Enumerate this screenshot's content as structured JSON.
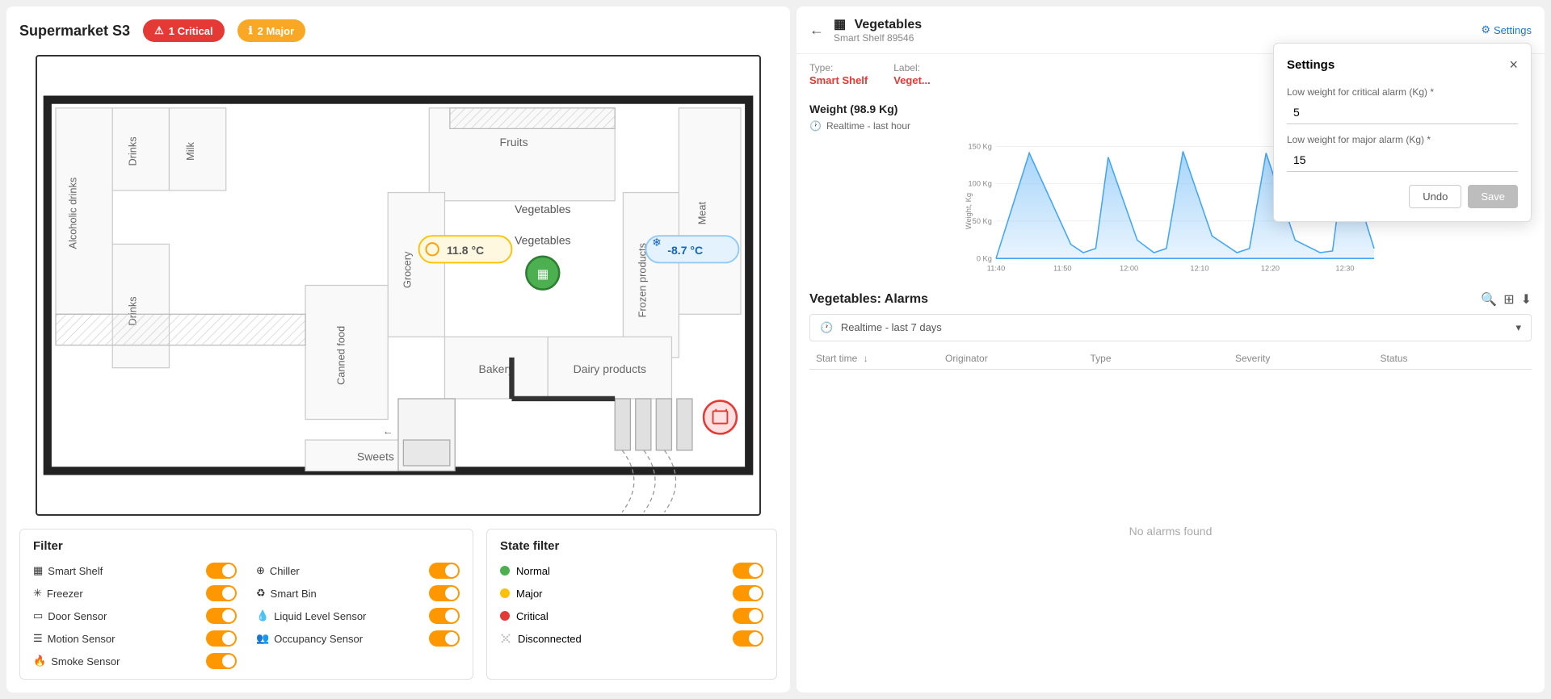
{
  "leftPanel": {
    "title": "Supermarket S3",
    "alerts": [
      {
        "type": "critical",
        "count": 1,
        "label": "1 Critical"
      },
      {
        "type": "major",
        "count": 2,
        "label": "2 Major"
      }
    ],
    "floorplan": {
      "sections": [
        "Fruits",
        "Drinks",
        "Milk",
        "Meat",
        "Alcoholic drinks",
        "Vegetables",
        "Frozen products",
        "Drinks",
        "Grocery",
        "Bakery",
        "Dairy products",
        "Canned food",
        "Sweets"
      ],
      "tempBadge1": "11.8 °C",
      "tempBadge2": "-8.7 °C"
    },
    "filter": {
      "title": "Filter",
      "items": [
        {
          "label": "Smart Shelf",
          "enabled": true
        },
        {
          "label": "Freezer",
          "enabled": true
        },
        {
          "label": "Door Sensor",
          "enabled": true
        },
        {
          "label": "Motion Sensor",
          "enabled": true
        },
        {
          "label": "Smoke Sensor",
          "enabled": true
        },
        {
          "label": "Chiller",
          "enabled": true
        },
        {
          "label": "Smart Bin",
          "enabled": true
        },
        {
          "label": "Liquid Level Sensor",
          "enabled": true
        },
        {
          "label": "Occupancy Sensor",
          "enabled": true
        }
      ]
    },
    "stateFilter": {
      "title": "State filter",
      "states": [
        {
          "label": "Normal",
          "color": "#4caf50",
          "enabled": true
        },
        {
          "label": "Major",
          "color": "#ffc107",
          "enabled": true
        },
        {
          "label": "Critical",
          "color": "#e53935",
          "enabled": true
        },
        {
          "label": "Disconnected",
          "color": "#bdbdbd",
          "enabled": true
        }
      ]
    }
  },
  "rightPanel": {
    "backArrow": "←",
    "deviceName": "Vegetables",
    "deviceId": "Smart Shelf 89546",
    "settingsLabel": "Settings",
    "meta": {
      "typeLabel": "Type:",
      "typeValue": "Smart Shelf",
      "labelLabel": "Label:",
      "labelValue": "Veget..."
    },
    "weight": {
      "title": "Weight (98.9 Kg)",
      "realtimeLabel": "Realtime - last hour",
      "chartYLabels": [
        "150 Kg",
        "100 Kg",
        "50 Kg",
        "0 Kg"
      ],
      "chartXLabels": [
        "11:40",
        "11:50",
        "12:00",
        "12:10",
        "12:20",
        "12:30"
      ],
      "chartYAxisLabel": "Weight, Kg"
    },
    "alarms": {
      "title": "Vegetables: Alarms",
      "realtimeLabel": "Realtime - last 7 days",
      "columns": [
        "Start time",
        "Originator",
        "Type",
        "Severity",
        "Status"
      ],
      "noAlarmsText": "No alarms found"
    },
    "settings": {
      "title": "Settings",
      "field1Label": "Low weight for critical alarm (Kg) *",
      "field1Value": "5",
      "field2Label": "Low weight for major alarm (Kg) *",
      "field2Value": "15",
      "undoLabel": "Undo",
      "saveLabel": "Save"
    }
  }
}
